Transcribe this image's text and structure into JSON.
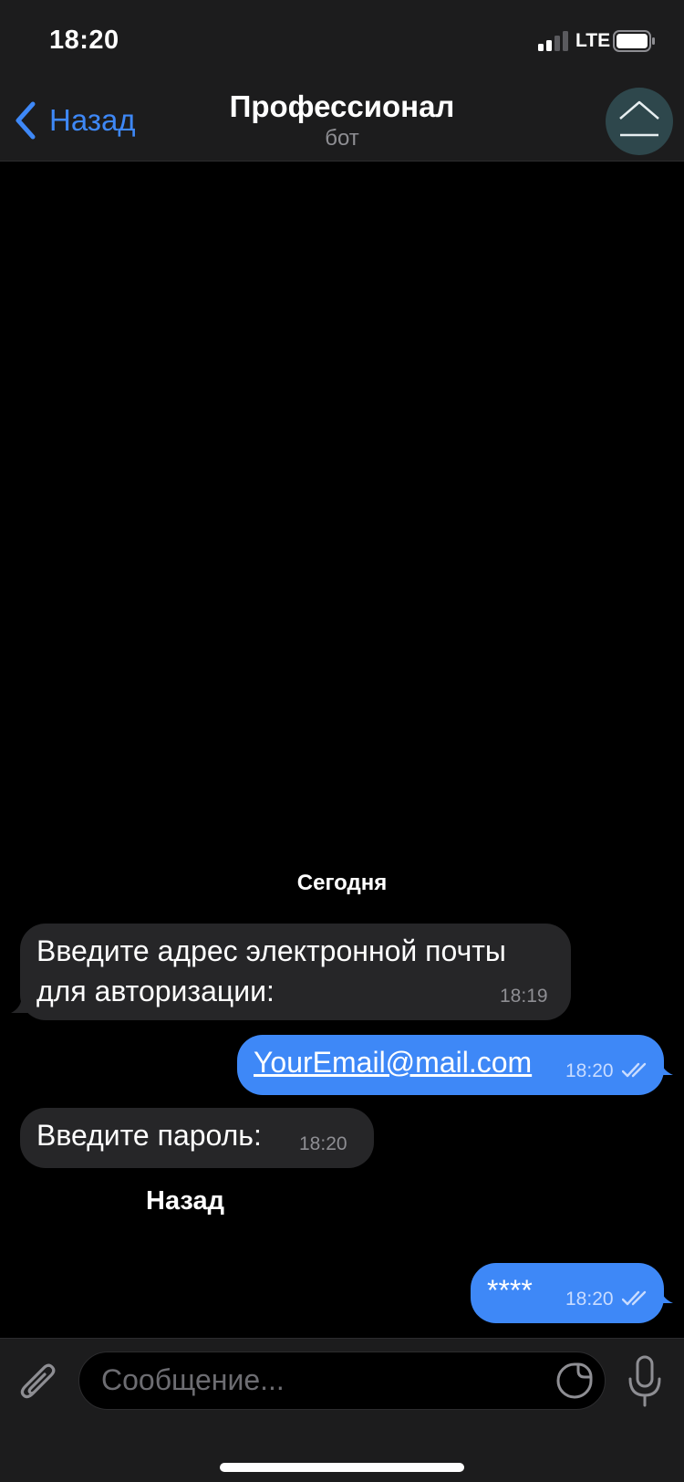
{
  "status_bar": {
    "time": "18:20",
    "network": "LTE"
  },
  "nav": {
    "back_label": "Назад",
    "title": "Профессионал",
    "subtitle": "бот"
  },
  "chat": {
    "date_label": "Сегодня",
    "messages": [
      {
        "direction": "in",
        "lines": [
          "Введите адрес электронной почты",
          "для авторизации:"
        ],
        "time": "18:19"
      },
      {
        "direction": "out",
        "text": "YourEmail@mail.com",
        "time": "18:20",
        "status": "read"
      },
      {
        "direction": "in",
        "text": "Введите пароль:",
        "time": "18:20"
      },
      {
        "direction": "out",
        "text": "****",
        "time": "18:20",
        "status": "read"
      }
    ],
    "keyboard_button": "Назад"
  },
  "input": {
    "placeholder": "Сообщение..."
  },
  "colors": {
    "accent": "#3e88f7",
    "bar_bg": "#1c1c1d",
    "incoming_bubble": "#262628",
    "background": "#000000"
  },
  "icons": [
    "signal-icon",
    "battery-icon",
    "back-chevron-icon",
    "avatar-icon",
    "paperclip-icon",
    "sticker-icon",
    "microphone-icon",
    "double-check-icon"
  ]
}
